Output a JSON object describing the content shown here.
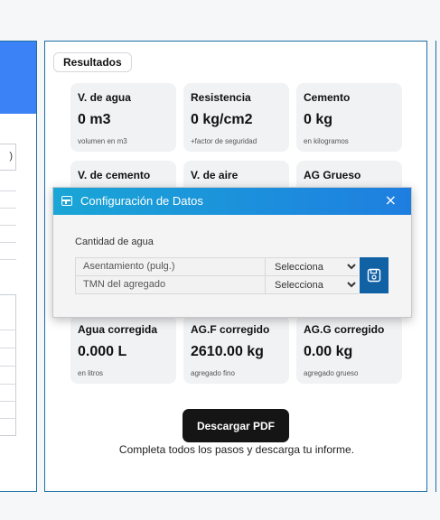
{
  "left_panel": {
    "box_text": ")"
  },
  "results": {
    "tag": "Resultados",
    "cards": [
      {
        "title": "V. de agua",
        "value": "0 m3",
        "sub": "volumen en m3"
      },
      {
        "title": "Resistencia",
        "value": "0 kg/cm2",
        "sub": "+factor de seguridad"
      },
      {
        "title": "Cemento",
        "value": "0 kg",
        "sub": "en kilogramos"
      },
      {
        "title": "V. de cemento",
        "value": "",
        "sub": ""
      },
      {
        "title": "V. de aire",
        "value": "",
        "sub": ""
      },
      {
        "title": "AG Grueso",
        "value": "",
        "sub": ""
      },
      {
        "title": "Agua corregida",
        "value": "0.000 L",
        "sub": "en litros"
      },
      {
        "title": "AG.F corregido",
        "value": "2610.00 kg",
        "sub": "agregado fino"
      },
      {
        "title": "AG.G corregido",
        "value": "0.00 kg",
        "sub": "agregado grueso"
      }
    ],
    "download_label": "Descargar PDF",
    "download_note": "Completa todos los pasos y descarga tu informe."
  },
  "modal": {
    "title": "Configuración de Datos",
    "close_label": "×",
    "group_label": "Cantidad de agua",
    "fields": [
      {
        "label": "Asentamiento (pulg.)",
        "selected": "Selecciona"
      },
      {
        "label": "TMN del agregado",
        "selected": "Selecciona"
      }
    ],
    "save_icon": "save-icon"
  },
  "colors": {
    "accent": "#1e7ee0",
    "border": "#1d6fa5",
    "save": "#1161a5",
    "button_dark": "#151515"
  }
}
